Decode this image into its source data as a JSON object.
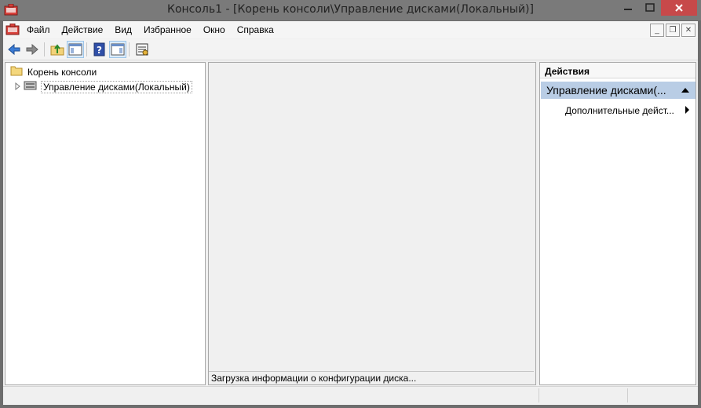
{
  "window": {
    "title": "Консоль1 - [Корень консоли\\Управление дисками(Локальный)]"
  },
  "menu": [
    "Файл",
    "Действие",
    "Вид",
    "Избранное",
    "Окно",
    "Справка"
  ],
  "toolbar": {
    "icons": [
      "back-arrow-icon",
      "forward-arrow-icon",
      "up-folder-icon",
      "show-hide-tree-icon",
      "help-icon",
      "show-hide-action-pane-icon",
      "properties-icon"
    ]
  },
  "tree": {
    "root": "Корень консоли",
    "child": "Управление дисками(Локальный)"
  },
  "center": {
    "status": "Загрузка информации о конфигурации диска..."
  },
  "actions": {
    "header": "Действия",
    "section": "Управление дисками(...",
    "item": "Дополнительные дейст..."
  },
  "colors": {
    "titlebar": "#7a7a7a",
    "close": "#c7494a",
    "selection": "#b9cde5",
    "arrow_blue": "#3a7bd5"
  }
}
